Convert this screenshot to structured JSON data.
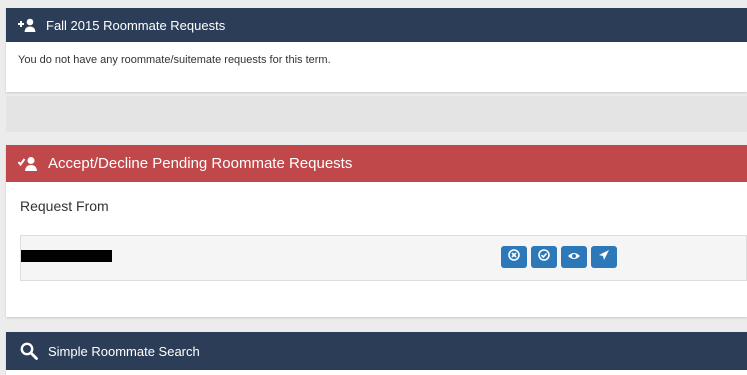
{
  "colors": {
    "navy_header": "#2c3e57",
    "red_header": "#c0474a",
    "button_blue": "#2c78b9",
    "page_bg": "#ececec"
  },
  "fall_panel": {
    "title": "Fall 2015 Roommate Requests",
    "icon": "add-user-icon",
    "message": "You do not have any roommate/suitemate requests for this term."
  },
  "pending_panel": {
    "title": "Accept/Decline Pending Roommate Requests",
    "icon": "accept-user-icon",
    "request_from_label": "Request From",
    "requests": [
      {
        "name_redacted": true,
        "actions": [
          {
            "icon": "decline-icon"
          },
          {
            "icon": "accept-icon"
          },
          {
            "icon": "view-icon"
          },
          {
            "icon": "send-icon"
          }
        ]
      }
    ]
  },
  "search_panel": {
    "title": "Simple Roommate Search",
    "icon": "search-icon"
  }
}
